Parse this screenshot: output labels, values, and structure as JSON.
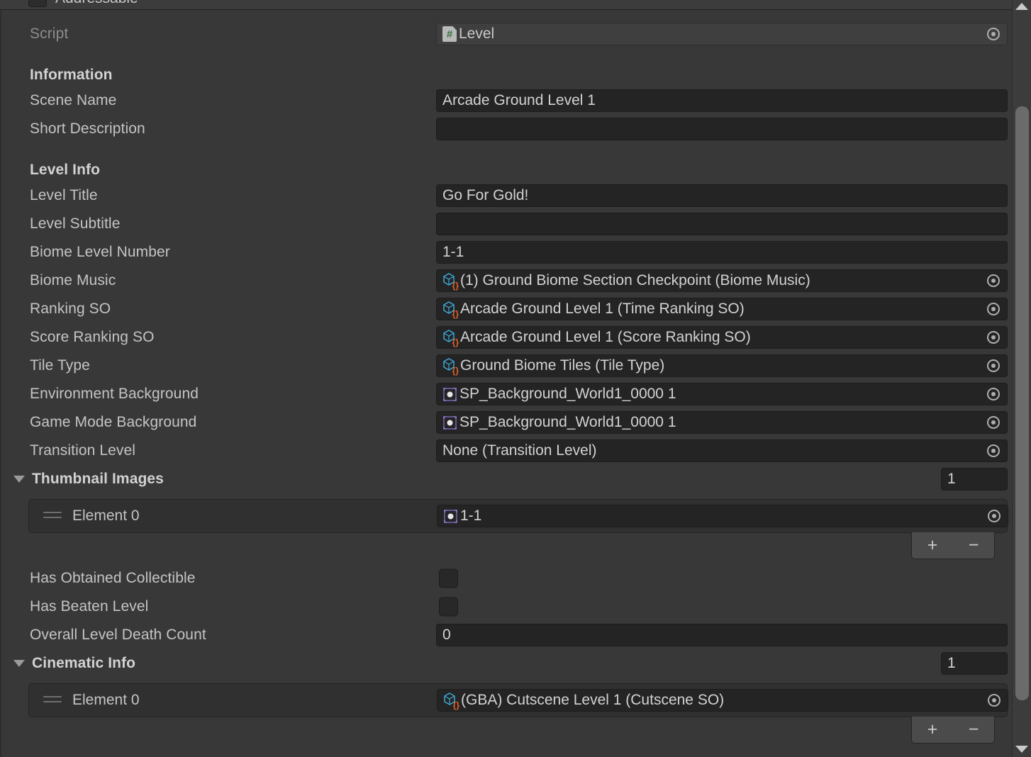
{
  "window": {
    "top_partial_row": {
      "label": "Addressable",
      "checked": false
    }
  },
  "script_row": {
    "label": "Script",
    "value": "Level",
    "icon": "csharp-script-icon"
  },
  "sections": [
    {
      "header": "Information"
    },
    {
      "header": "Level Info"
    }
  ],
  "fields": {
    "scene_name": {
      "label": "Scene Name",
      "value": "Arcade Ground Level 1"
    },
    "short_desc": {
      "label": "Short Description",
      "value": ""
    },
    "level_title": {
      "label": "Level Title",
      "value": "Go For Gold!"
    },
    "level_sub": {
      "label": "Level Subtitle",
      "value": ""
    },
    "biome_num": {
      "label": "Biome Level Number",
      "value": "1-1"
    },
    "biome_music": {
      "label": "Biome Music",
      "value": "(1) Ground Biome Section Checkpoint (Biome Music)",
      "icon": "scriptable-object-icon"
    },
    "ranking_so": {
      "label": "Ranking SO",
      "value": "Arcade Ground Level 1 (Time Ranking SO)",
      "icon": "scriptable-object-icon"
    },
    "score_rank": {
      "label": "Score Ranking SO",
      "value": "Arcade Ground Level 1 (Score Ranking SO)",
      "icon": "scriptable-object-icon"
    },
    "tile_type": {
      "label": "Tile Type",
      "value": "Ground Biome Tiles (Tile Type)",
      "icon": "scriptable-object-icon"
    },
    "env_bg": {
      "label": "Environment Background",
      "value": "SP_Background_World1_0000 1",
      "icon": "sprite-icon"
    },
    "mode_bg": {
      "label": "Game Mode Background",
      "value": "SP_Background_World1_0000 1",
      "icon": "sprite-icon"
    },
    "transition": {
      "label": "Transition Level",
      "value": "None (Transition Level)"
    },
    "has_collect": {
      "label": "Has Obtained Collectible",
      "checked": false
    },
    "has_beaten": {
      "label": "Has Beaten Level",
      "checked": false
    },
    "death_count": {
      "label": "Overall Level Death Count",
      "value": "0"
    }
  },
  "thumbnail_images": {
    "header": "Thumbnail Images",
    "size": "1",
    "elements": [
      {
        "label": "Element 0",
        "value": "1-1",
        "icon": "sprite-icon"
      }
    ]
  },
  "cinematic_info": {
    "header": "Cinematic Info",
    "size": "1",
    "elements": [
      {
        "label": "Element 0",
        "value": "(GBA) Cutscene Level 1 (Cutscene SO)",
        "icon": "scriptable-object-icon"
      }
    ]
  },
  "list_footer": {
    "add_label": "+",
    "remove_label": "−"
  },
  "colors": {
    "background": "#383838",
    "field_background": "#242424",
    "text": "#c4c4c4",
    "dim_text": "#8c8c8c",
    "sprite_icon": "#9a7de0",
    "scriptable_cube": "#3ba9d6",
    "scriptable_braces": "#e4622a",
    "csharp_green": "#39703c",
    "scrollbar_thumb": "#6b6b6b"
  }
}
